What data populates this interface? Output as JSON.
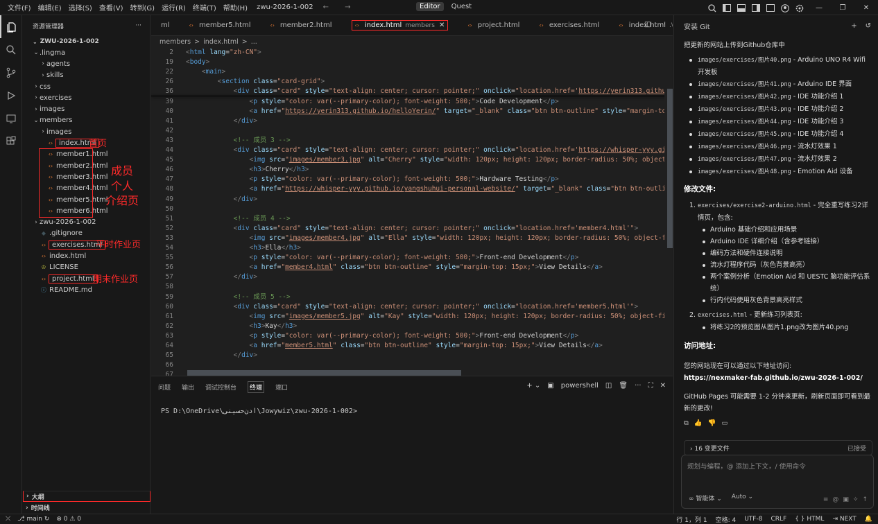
{
  "menu": [
    "文件(F)",
    "编辑(E)",
    "选择(S)",
    "查看(V)",
    "转到(G)",
    "运行(R)",
    "终端(T)",
    "帮助(H)"
  ],
  "workspace_name": "zwu-2026-1-002",
  "modes": {
    "editor": "Editor",
    "quest": "Quest"
  },
  "explorer": {
    "title": "资源管理器",
    "root": "ZWU-2026-1-002",
    "items": [
      {
        "label": ".lingma",
        "indent": 1,
        "type": "folder",
        "open": true
      },
      {
        "label": "agents",
        "indent": 2,
        "type": "folder",
        "open": false
      },
      {
        "label": "skills",
        "indent": 2,
        "type": "folder",
        "open": false
      },
      {
        "label": "css",
        "indent": 1,
        "type": "folder",
        "open": false
      },
      {
        "label": "exercises",
        "indent": 1,
        "type": "folder",
        "open": false
      },
      {
        "label": "images",
        "indent": 1,
        "type": "folder",
        "open": false
      },
      {
        "label": "members",
        "indent": 1,
        "type": "folder",
        "open": true
      },
      {
        "label": "images",
        "indent": 2,
        "type": "folder",
        "open": false
      },
      {
        "label": "index.html",
        "indent": 2,
        "type": "html",
        "box": true
      },
      {
        "label": "member1.html",
        "indent": 2,
        "type": "html"
      },
      {
        "label": "member2.html",
        "indent": 2,
        "type": "html"
      },
      {
        "label": "member3.html",
        "indent": 2,
        "type": "html"
      },
      {
        "label": "member4.html",
        "indent": 2,
        "type": "html"
      },
      {
        "label": "member5.html",
        "indent": 2,
        "type": "html"
      },
      {
        "label": "member6.html",
        "indent": 2,
        "type": "html"
      },
      {
        "label": "zwu-2026-1-002",
        "indent": 1,
        "type": "folder",
        "open": false
      },
      {
        "label": ".gitignore",
        "indent": 1,
        "type": "git"
      },
      {
        "label": "exercises.html",
        "indent": 1,
        "type": "html",
        "box": true
      },
      {
        "label": "index.html",
        "indent": 1,
        "type": "html"
      },
      {
        "label": "LICENSE",
        "indent": 1,
        "type": "lic"
      },
      {
        "label": "project.html",
        "indent": 1,
        "type": "html",
        "box": true
      },
      {
        "label": "README.md",
        "indent": 1,
        "type": "md"
      }
    ],
    "outline": "大纲",
    "timeline": "时间线"
  },
  "annotations": {
    "home": "首页",
    "members": [
      "成员",
      "个人",
      "介绍页"
    ],
    "exercises": "平时作业页",
    "project": "期末作业页"
  },
  "tabs": [
    {
      "label": "ml",
      "icon": false
    },
    {
      "label": "member5.html",
      "icon": true
    },
    {
      "label": "member2.html",
      "icon": true
    },
    {
      "label": "index.html",
      "desc": "members",
      "icon": true,
      "active": true
    },
    {
      "label": "project.html",
      "icon": true
    },
    {
      "label": "exercises.html",
      "icon": true
    },
    {
      "label": "index.html",
      "desc": ".\\",
      "icon": true
    }
  ],
  "breadcrumb": [
    "members",
    ">",
    "index.html",
    ">",
    "..."
  ],
  "code_lines": [
    {
      "n": "2",
      "html": "<span class='t'>&lt;</span><span class='tg'>html</span> <span class='at'>lang</span><span class='tx'>=</span><span class='st'>\"zh-CN\"</span><span class='t'>&gt;</span>"
    },
    {
      "n": "19",
      "html": "<span class='t'>&lt;</span><span class='tg'>body</span><span class='t'>&gt;</span>"
    },
    {
      "n": "22",
      "html": "    <span class='t'>&lt;</span><span class='tg'>main</span><span class='t'>&gt;</span>"
    },
    {
      "n": "26",
      "html": "        <span class='t'>&lt;</span><span class='tg'>section</span> <span class='at'>class</span><span class='tx'>=</span><span class='st'>\"card-grid\"</span><span class='t'>&gt;</span>"
    },
    {
      "n": "36",
      "html": "            <span class='t'>&lt;</span><span class='tg'>div</span> <span class='at'>class</span><span class='tx'>=</span><span class='st'>\"card\"</span> <span class='at'>style</span><span class='tx'>=</span><span class='st'>\"text-align: center; cursor: pointer;\"</span> <span class='at'>onclick</span><span class='tx'>=</span><span class='st'>\"location.href='<span class='lk'>https://yerin313.githu</span></span>"
    },
    {
      "n": "39",
      "html": "                <span class='t'>&lt;</span><span class='tg'>p</span> <span class='at'>style</span><span class='tx'>=</span><span class='st'>\"color: var(--primary-color); font-weight: 500;\"</span><span class='t'>&gt;</span><span class='tx'>Code Development</span><span class='t'>&lt;/</span><span class='tg'>p</span><span class='t'>&gt;</span>"
    },
    {
      "n": "40",
      "html": "                <span class='t'>&lt;</span><span class='tg'>a</span> <span class='at'>href</span><span class='tx'>=</span><span class='st'>\"<span class='lk'>https://yerin313.github.io/helloYerin/</span>\"</span> <span class='at'>target</span><span class='tx'>=</span><span class='st'>\"_blank\"</span> <span class='at'>class</span><span class='tx'>=</span><span class='st'>\"btn btn-outline\"</span> <span class='at'>style</span><span class='tx'>=</span><span class='st'>\"margin-top:</span>"
    },
    {
      "n": "41",
      "html": "            <span class='t'>&lt;/</span><span class='tg'>div</span><span class='t'>&gt;</span>"
    },
    {
      "n": "42",
      "html": ""
    },
    {
      "n": "43",
      "html": "            <span class='cm'>&lt;!-- 成员 3 --&gt;</span>"
    },
    {
      "n": "44",
      "html": "            <span class='t'>&lt;</span><span class='tg'>div</span> <span class='at'>class</span><span class='tx'>=</span><span class='st'>\"card\"</span> <span class='at'>style</span><span class='tx'>=</span><span class='st'>\"text-align: center; cursor: pointer;\"</span> <span class='at'>onclick</span><span class='tx'>=</span><span class='st'>\"location.href='<span class='lk'>https://whisper-yyy.gith</span></span>"
    },
    {
      "n": "45",
      "html": "                <span class='t'>&lt;</span><span class='tg'>img</span> <span class='at'>src</span><span class='tx'>=</span><span class='st'>\"<span class='lk'>images/member3.jpg</span>\"</span> <span class='at'>alt</span><span class='tx'>=</span><span class='st'>\"Cherry\"</span> <span class='at'>style</span><span class='tx'>=</span><span class='st'>\"width: 120px; height: 120px; border-radius: 50%; object-fi</span>"
    },
    {
      "n": "46",
      "html": "                <span class='t'>&lt;</span><span class='tg'>h3</span><span class='t'>&gt;</span><span class='tx'>Cherry</span><span class='t'>&lt;/</span><span class='tg'>h3</span><span class='t'>&gt;</span>"
    },
    {
      "n": "47",
      "html": "                <span class='t'>&lt;</span><span class='tg'>p</span> <span class='at'>style</span><span class='tx'>=</span><span class='st'>\"color: var(--primary-color); font-weight: 500;\"</span><span class='t'>&gt;</span><span class='tx'>Hardware Testing</span><span class='t'>&lt;/</span><span class='tg'>p</span><span class='t'>&gt;</span>"
    },
    {
      "n": "48",
      "html": "                <span class='t'>&lt;</span><span class='tg'>a</span> <span class='at'>href</span><span class='tx'>=</span><span class='st'>\"<span class='lk'>https://whisper-yyy.github.io/yangshuhui-personal-website/</span>\"</span> <span class='at'>target</span><span class='tx'>=</span><span class='st'>\"_blank\"</span> <span class='at'>class</span><span class='tx'>=</span><span class='st'>\"btn btn-outline</span>"
    },
    {
      "n": "49",
      "html": "            <span class='t'>&lt;/</span><span class='tg'>div</span><span class='t'>&gt;</span>"
    },
    {
      "n": "50",
      "html": ""
    },
    {
      "n": "51",
      "html": "            <span class='cm'>&lt;!-- 成员 4 --&gt;</span>"
    },
    {
      "n": "52",
      "html": "            <span class='t'>&lt;</span><span class='tg'>div</span> <span class='at'>class</span><span class='tx'>=</span><span class='st'>\"card\"</span> <span class='at'>style</span><span class='tx'>=</span><span class='st'>\"text-align: center; cursor: pointer;\"</span> <span class='at'>onclick</span><span class='tx'>=</span><span class='st'>\"location.href='member4.html'\"</span><span class='t'>&gt;</span>"
    },
    {
      "n": "53",
      "html": "                <span class='t'>&lt;</span><span class='tg'>img</span> <span class='at'>src</span><span class='tx'>=</span><span class='st'>\"<span class='lk'>images/member4.jpg</span>\"</span> <span class='at'>alt</span><span class='tx'>=</span><span class='st'>\"Ella\"</span> <span class='at'>style</span><span class='tx'>=</span><span class='st'>\"width: 120px; height: 120px; border-radius: 50%; object-fit</span>"
    },
    {
      "n": "54",
      "html": "                <span class='t'>&lt;</span><span class='tg'>h3</span><span class='t'>&gt;</span><span class='tx'>Ella</span><span class='t'>&lt;/</span><span class='tg'>h3</span><span class='t'>&gt;</span>"
    },
    {
      "n": "55",
      "html": "                <span class='t'>&lt;</span><span class='tg'>p</span> <span class='at'>style</span><span class='tx'>=</span><span class='st'>\"color: var(--primary-color); font-weight: 500;\"</span><span class='t'>&gt;</span><span class='tx'>Front-end Development</span><span class='t'>&lt;/</span><span class='tg'>p</span><span class='t'>&gt;</span>"
    },
    {
      "n": "56",
      "html": "                <span class='t'>&lt;</span><span class='tg'>a</span> <span class='at'>href</span><span class='tx'>=</span><span class='st'>\"<span class='lk'>member4.html</span>\"</span> <span class='at'>class</span><span class='tx'>=</span><span class='st'>\"btn btn-outline\"</span> <span class='at'>style</span><span class='tx'>=</span><span class='st'>\"margin-top: 15px;\"</span><span class='t'>&gt;</span><span class='tx'>View Details</span><span class='t'>&lt;/</span><span class='tg'>a</span><span class='t'>&gt;</span>"
    },
    {
      "n": "57",
      "html": "            <span class='t'>&lt;/</span><span class='tg'>div</span><span class='t'>&gt;</span>"
    },
    {
      "n": "58",
      "html": ""
    },
    {
      "n": "59",
      "html": "            <span class='cm'>&lt;!-- 成员 5 --&gt;</span>"
    },
    {
      "n": "60",
      "html": "            <span class='t'>&lt;</span><span class='tg'>div</span> <span class='at'>class</span><span class='tx'>=</span><span class='st'>\"card\"</span> <span class='at'>style</span><span class='tx'>=</span><span class='st'>\"text-align: center; cursor: pointer;\"</span> <span class='at'>onclick</span><span class='tx'>=</span><span class='st'>\"location.href='member5.html'\"</span><span class='t'>&gt;</span>"
    },
    {
      "n": "61",
      "html": "                <span class='t'>&lt;</span><span class='tg'>img</span> <span class='at'>src</span><span class='tx'>=</span><span class='st'>\"<span class='lk'>images/member5.jpg</span>\"</span> <span class='at'>alt</span><span class='tx'>=</span><span class='st'>\"Kay\"</span> <span class='at'>style</span><span class='tx'>=</span><span class='st'>\"width: 120px; height: 120px; border-radius: 50%; object-fit:</span>"
    },
    {
      "n": "62",
      "html": "                <span class='t'>&lt;</span><span class='tg'>h3</span><span class='t'>&gt;</span><span class='tx'>Kay</span><span class='t'>&lt;/</span><span class='tg'>h3</span><span class='t'>&gt;</span>"
    },
    {
      "n": "63",
      "html": "                <span class='t'>&lt;</span><span class='tg'>p</span> <span class='at'>style</span><span class='tx'>=</span><span class='st'>\"color: var(--primary-color); font-weight: 500;\"</span><span class='t'>&gt;</span><span class='tx'>Front-end Development</span><span class='t'>&lt;/</span><span class='tg'>p</span><span class='t'>&gt;</span>"
    },
    {
      "n": "64",
      "html": "                <span class='t'>&lt;</span><span class='tg'>a</span> <span class='at'>href</span><span class='tx'>=</span><span class='st'>\"<span class='lk'>member5.html</span>\"</span> <span class='at'>class</span><span class='tx'>=</span><span class='st'>\"btn btn-outline\"</span> <span class='at'>style</span><span class='tx'>=</span><span class='st'>\"margin-top: 15px;\"</span><span class='t'>&gt;</span><span class='tx'>View Details</span><span class='t'>&lt;/</span><span class='tg'>a</span><span class='t'>&gt;</span>"
    },
    {
      "n": "65",
      "html": "            <span class='t'>&lt;/</span><span class='tg'>div</span><span class='t'>&gt;</span>"
    },
    {
      "n": "66",
      "html": ""
    },
    {
      "n": "67",
      "html": "            <span class='cm'>&lt;!-- 成员 6 --&gt;</span>"
    }
  ],
  "panel": {
    "tabs": [
      "问题",
      "输出",
      "调试控制台",
      "终端",
      "端口"
    ],
    "active_tab": "终端",
    "shell": "powershell",
    "prompt": "PS D:\\OneDrive\\ادن‌حسینی\\Jowywiz\\zwu-2026-1-002>"
  },
  "chat": {
    "title": "安装 Git",
    "intro": "把更新的网站上传到Github仓库中",
    "image_items": [
      {
        "code": "images/exercises/图片40.png",
        "text": "- Arduino UNO R4 Wifi 开发板"
      },
      {
        "code": "images/exercises/图片41.png",
        "text": "- Arduino IDE 界面"
      },
      {
        "code": "images/exercises/图片42.png",
        "text": "- IDE 功能介绍 1"
      },
      {
        "code": "images/exercises/图片43.png",
        "text": "- IDE 功能介绍 2"
      },
      {
        "code": "images/exercises/图片44.png",
        "text": "- IDE 功能介绍 3"
      },
      {
        "code": "images/exercises/图片45.png",
        "text": "- IDE 功能介绍 4"
      },
      {
        "code": "images/exercises/图片46.png",
        "text": "- 流水灯效果 1"
      },
      {
        "code": "images/exercises/图片47.png",
        "text": "- 流水灯效果 2"
      },
      {
        "code": "images/exercises/图片48.png",
        "text": "- Emotion Aid 设备"
      }
    ],
    "modified_heading": "修改文件:",
    "mod1_code": "exercises/exercise2-arduino.html",
    "mod1_text": "- 完全重写练习2详情页，包含:",
    "mod1_items": [
      "Arduino 基础介绍和应用场景",
      "Arduino IDE 详细介绍（含参考链接）",
      "编码方法和硬件连接说明",
      "流水灯程序代码（灰色背景高亮）",
      "两个案例分析（Emotion Aid 和 UESTC 脑功能评估系统）",
      "行内代码使用灰色背景高亮样式"
    ],
    "mod2_code": "exercises.html",
    "mod2_text": "- 更新练习列表页:",
    "mod2_items": [
      "将练习2的预览图从图片1.png改为图片40.png"
    ],
    "access_heading": "访问地址:",
    "access_text": "您的网站现在可以通过以下地址访问:",
    "access_url": "https://nexmaker-fab.github.io/zwu-2026-1-002/",
    "pages_note": "GitHub Pages 可能需要 1-2 分钟来更新，刷新页面即可看到最新的更改!",
    "changes_label": "16 变更文件",
    "changes_status": "已接受",
    "input_placeholder": "规划与编程，@ 添加上下文，/ 使用命令",
    "agent_label": "智能体",
    "model_label": "Auto"
  },
  "status": {
    "branch": "main",
    "errors": "0",
    "warnings": "0",
    "position": "行 1，列 1",
    "spaces": "空格: 4",
    "encoding": "UTF-8",
    "eol": "CRLF",
    "lang": "HTML",
    "next": "NEXT"
  }
}
